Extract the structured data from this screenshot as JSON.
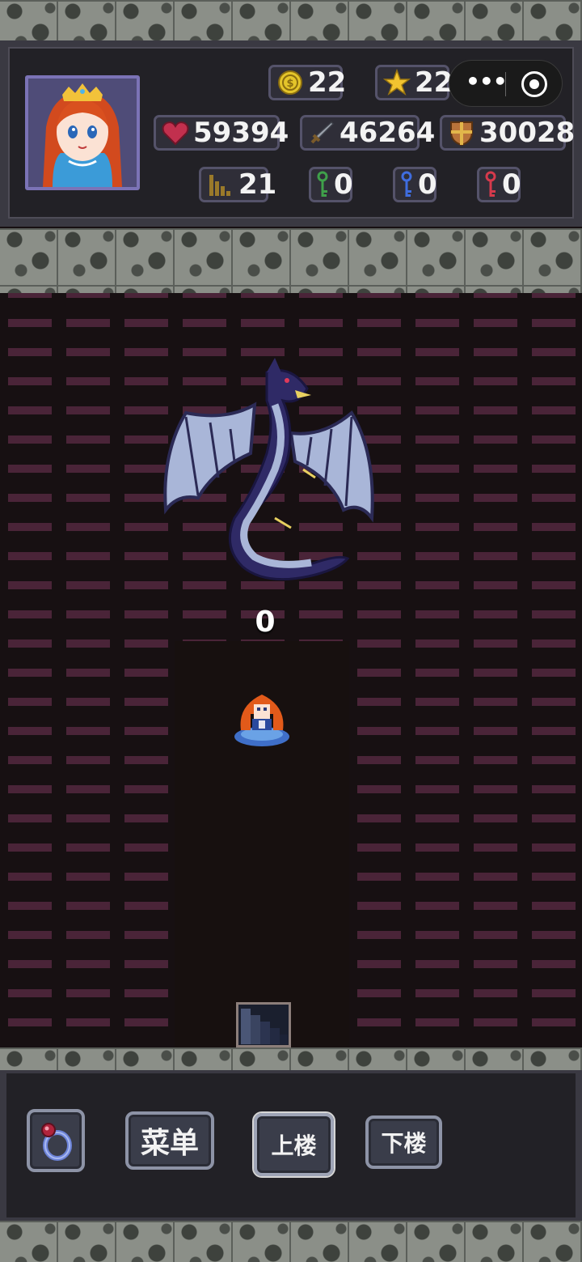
{
  "hud": {
    "coins": "22",
    "stars": "22",
    "hp": "59394",
    "attack": "46264",
    "defense": "30028",
    "floor": "21",
    "green_keys": "0",
    "blue_keys": "0",
    "red_keys": "0"
  },
  "capsule": {
    "more_label": "•••"
  },
  "battle": {
    "damage": "0"
  },
  "controls": {
    "menu_label": "菜单",
    "up_label": "上楼",
    "down_label": "下楼"
  },
  "icons": {
    "coin": "coin-icon",
    "star": "star-icon",
    "heart": "heart-icon",
    "sword": "sword-icon",
    "shield": "shield-icon",
    "stairs": "stairs-icon",
    "green_key": "green-key-icon",
    "blue_key": "blue-key-icon",
    "red_key": "red-key-icon",
    "ring": "ring-icon"
  },
  "colors": {
    "green_key": "#3fa04a",
    "blue_key": "#3f6de0",
    "red_key": "#d63a4c",
    "coin": "#e4c52a",
    "heart": "#c2304e"
  }
}
